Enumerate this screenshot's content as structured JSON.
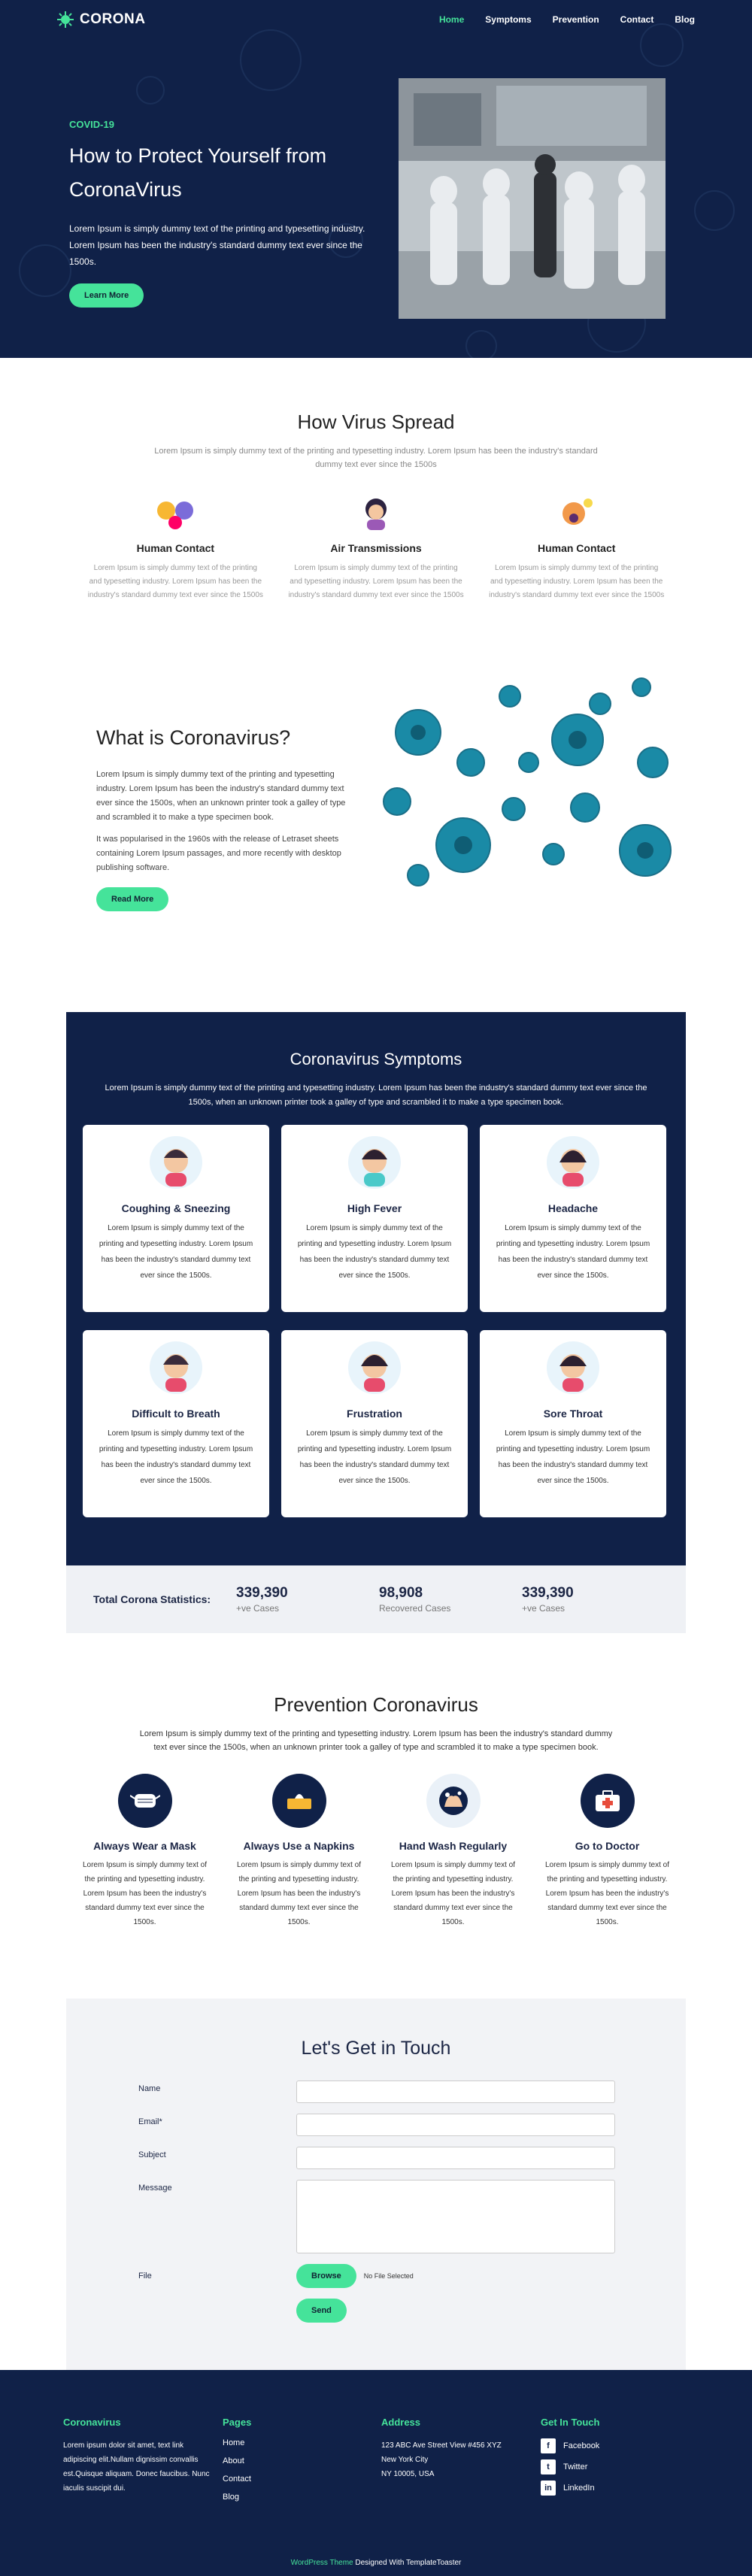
{
  "brand": {
    "name": "CORONA",
    "accent": "#45e39a",
    "navy": "#102148"
  },
  "nav": [
    {
      "label": "Home",
      "active": true
    },
    {
      "label": "Symptoms"
    },
    {
      "label": "Prevention"
    },
    {
      "label": "Contact"
    },
    {
      "label": "Blog"
    }
  ],
  "hero": {
    "kicker": "COVID-19",
    "title": "How to Protect Yourself from CoronaVirus",
    "desc": "Lorem Ipsum is simply dummy text of the printing and typesetting industry. Lorem Ipsum has been the industry's standard dummy text ever since the 1500s.",
    "button": "Learn More"
  },
  "spread": {
    "title": "How Virus Spread",
    "sub": "Lorem Ipsum is simply dummy text of the printing and typesetting industry. Lorem Ipsum has been the industry's standard dummy text ever since the 1500s",
    "items": [
      {
        "title": "Human Contact",
        "text": "Lorem Ipsum is simply dummy text of the printing and typesetting industry. Lorem Ipsum has been the industry's standard dummy text ever since the 1500s"
      },
      {
        "title": "Air Transmissions",
        "text": "Lorem Ipsum is simply dummy text of the printing and typesetting industry. Lorem Ipsum has been the industry's standard dummy text ever since the 1500s"
      },
      {
        "title": "Human Contact",
        "text": "Lorem Ipsum is simply dummy text of the printing and typesetting industry. Lorem Ipsum has been the industry's standard dummy text ever since the 1500s"
      }
    ]
  },
  "whatis": {
    "title": "What is Coronavirus?",
    "p1": "Lorem Ipsum is simply dummy text of the printing and typesetting industry. Lorem Ipsum has been the industry's standard dummy text ever since the 1500s, when an unknown printer took a galley of type and scrambled it to make a type specimen book.",
    "p2": "It was popularised in the 1960s with the release of Letraset sheets containing Lorem Ipsum passages, and more recently with desktop publishing software.",
    "button": "Read More"
  },
  "symptoms": {
    "title": "Coronavirus Symptoms",
    "lead": "Lorem Ipsum is simply dummy text of the printing and typesetting industry. Lorem Ipsum has been the industry's standard dummy text ever since the 1500s, when an unknown printer took a galley of type and scrambled it to make a type specimen book.",
    "cards": [
      {
        "title": "Coughing & Sneezing",
        "text": "Lorem Ipsum is simply dummy text of the printing and typesetting industry. Lorem Ipsum has been the industry's standard dummy text ever since the 1500s."
      },
      {
        "title": "High Fever",
        "text": "Lorem Ipsum is simply dummy text of the printing and typesetting industry. Lorem Ipsum has been the industry's standard dummy text ever since the 1500s."
      },
      {
        "title": "Headache",
        "text": "Lorem Ipsum is simply dummy text of the printing and typesetting industry. Lorem Ipsum has been the industry's standard dummy text ever since the 1500s."
      },
      {
        "title": "Difficult to Breath",
        "text": "Lorem Ipsum is simply dummy text of the printing and typesetting industry. Lorem Ipsum has been the industry's standard dummy text ever since the 1500s."
      },
      {
        "title": "Frustration",
        "text": "Lorem Ipsum is simply dummy text of the printing and typesetting industry. Lorem Ipsum has been the industry's standard dummy text ever since the 1500s."
      },
      {
        "title": "Sore Throat",
        "text": "Lorem Ipsum is simply dummy text of the printing and typesetting industry. Lorem Ipsum has been the industry's standard dummy text ever since the 1500s."
      }
    ]
  },
  "stats": {
    "label": "Total Corona Statistics:",
    "items": [
      {
        "num": "339,390",
        "cap": "+ve Cases"
      },
      {
        "num": "98,908",
        "cap": "Recovered Cases"
      },
      {
        "num": "339,390",
        "cap": "+ve Cases"
      }
    ]
  },
  "prevention": {
    "title": "Prevention Coronavirus",
    "sub": "Lorem Ipsum is simply dummy text of the printing and typesetting industry. Lorem Ipsum has been the industry's standard dummy text ever since the 1500s, when an unknown printer took a galley of type and scrambled it to make a type specimen book.",
    "items": [
      {
        "title": "Always Wear a Mask",
        "icon": "mask-icon",
        "text": "Lorem Ipsum is simply dummy text of the printing and typesetting industry. Lorem Ipsum has been the industry's standard dummy text ever since the 1500s."
      },
      {
        "title": "Always Use a Napkins",
        "icon": "napkin-icon",
        "text": "Lorem Ipsum is simply dummy text of the printing and typesetting industry. Lorem Ipsum has been the industry's standard dummy text ever since the 1500s."
      },
      {
        "title": "Hand Wash Regularly",
        "icon": "hand-wash-icon",
        "text": "Lorem Ipsum is simply dummy text of the printing and typesetting industry. Lorem Ipsum has been the industry's standard dummy text ever since the 1500s."
      },
      {
        "title": "Go to Doctor",
        "icon": "medical-kit-icon",
        "text": "Lorem Ipsum is simply dummy text of the printing and typesetting industry. Lorem Ipsum has been the industry's standard dummy text ever since the 1500s."
      }
    ]
  },
  "contact": {
    "title": "Let's Get in Touch",
    "name_label": "Name",
    "email_label": "Email*",
    "subject_label": "Subject",
    "message_label": "Message",
    "file_label": "File",
    "browse": "Browse",
    "file_status": "No File Selected",
    "send": "Send"
  },
  "footer": {
    "brand": "Coronavirus",
    "about": "Lorem ipsum dolor sit amet, text link adipiscing elit.Nullam dignissim convallis est.Quisque aliquam. Donec faucibus. Nunc iaculis suscipit dui.",
    "pages_title": "Pages",
    "pages": [
      "Home",
      "About",
      "Contact",
      "Blog"
    ],
    "address_title": "Address",
    "address": [
      "123 ABC Ave Street View #456 XYZ",
      "New York City",
      "NY 10005, USA"
    ],
    "social_title": "Get In Touch",
    "social": [
      "Facebook",
      "Twitter",
      "LinkedIn"
    ],
    "credit_link": "WordPress Theme",
    "credit_text": " Designed With TemplateToaster"
  }
}
